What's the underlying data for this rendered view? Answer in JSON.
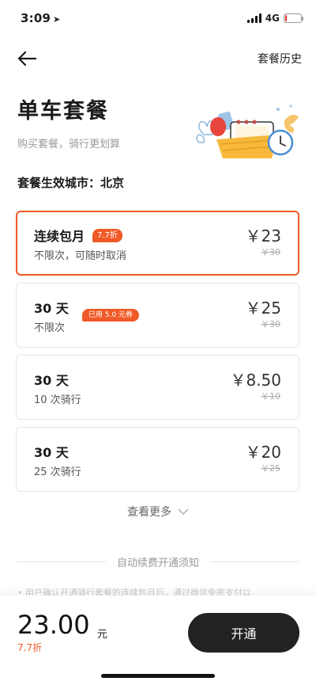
{
  "status_bar": {
    "time": "3:09",
    "network": "4G"
  },
  "nav": {
    "history_label": "套餐历史"
  },
  "hero": {
    "title": "单车套餐",
    "subtitle": "购买套餐，骑行更划算"
  },
  "city": {
    "label": "套餐生效城市：北京"
  },
  "plans": [
    {
      "name": "连续包月",
      "badge": "7.7折",
      "desc": "不限次，可随时取消",
      "price": "￥23",
      "original": "￥30",
      "selected": true
    },
    {
      "name": "30 天",
      "badge": "已用 5.0 元券",
      "desc": "不限次",
      "price": "￥25",
      "original": "￥30",
      "selected": false
    },
    {
      "name": "30 天",
      "badge": "",
      "desc": "10 次骑行",
      "price": "￥8.50",
      "original": "￥10",
      "selected": false
    },
    {
      "name": "30 天",
      "badge": "",
      "desc": "25 次骑行",
      "price": "￥20",
      "original": "￥25",
      "selected": false
    }
  ],
  "more": {
    "label": "查看更多"
  },
  "notice": {
    "title": "自动续费开通须知",
    "text": "• 用户确认开通骑行套餐的连续包月后，通过微信免密支付以"
  },
  "checkout": {
    "amount": "23.00",
    "unit": "元",
    "discount": "7.7折",
    "button_label": "开通"
  },
  "colors": {
    "accent": "#f05a28",
    "button": "#222222",
    "text": "#1a1a1a",
    "muted": "#9a9a9a"
  },
  "icons": [
    "back-arrow-icon",
    "chevron-down-icon",
    "signal-icon",
    "battery-icon",
    "location-arrow-icon"
  ]
}
